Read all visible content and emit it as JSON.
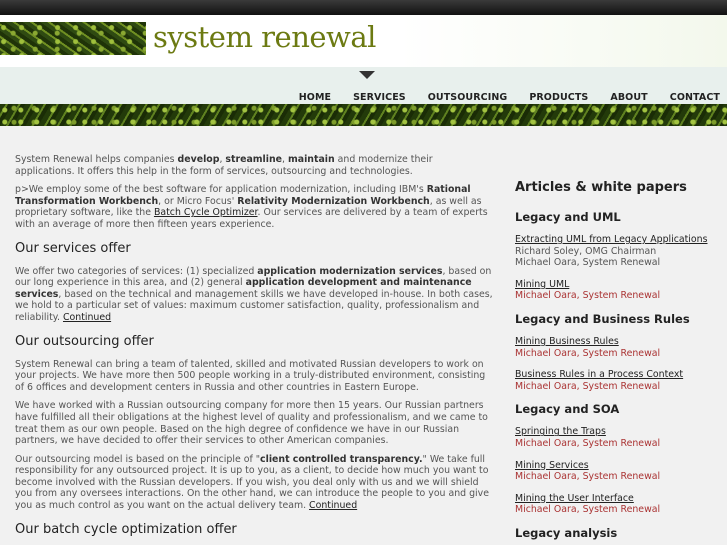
{
  "header": {
    "site_title": "system renewal"
  },
  "nav": {
    "items": [
      "HOME",
      "SERVICES",
      "OUTSOURCING",
      "PRODUCTS",
      "ABOUT",
      "CONTACT"
    ]
  },
  "main": {
    "intro_1": "System Renewal helps companies ",
    "intro_b1": "develop",
    "intro_b2": "streamline",
    "intro_b3": "maintain",
    "intro_2": " and modernize their applications. It offers this help in the form of services, outsourcing and technologies.",
    "p2_a": "p>We employ some of the best software for application modernization, including IBM's ",
    "p2_b1": "Rational Transformation Workbench",
    "p2_b": ", or Micro Focus' ",
    "p2_b2": "Relativity Modernization Workbench",
    "p2_c": ", as well as proprietary software, like the ",
    "p2_link": "Batch Cycle Optimizer",
    "p2_d": ". Our services are delivered by a team of experts with an average of more then fifteen years experience.",
    "h_services": "Our services offer",
    "p3_a": "We offer two categories of services: (1) specialized ",
    "p3_b1": "application modernization services",
    "p3_b": ", based on our long experience in this area, and (2) general ",
    "p3_b2": "application development and maintenance services",
    "p3_c": ", based on the technical and management skills we have developed in-house. In both cases, we hold to a particular set of values: maximum customer satisfaction, quality, professionalism and reliability. ",
    "p3_link": "Continued",
    "h_outsourcing": "Our outsourcing offer",
    "p4": "System Renewal can bring a team of talented, skilled and motivated Russian developers to work on your projects. We have more then 500 people working in a truly-distributed environment, consisting of 6 offices and development centers in Russia and other countries in Eastern Europe.",
    "p5": "We have worked with a Russian outsourcing company for more then 15 years. Our Russian partners have fulfilled all their obligations at the highest level of quality and professionalism, and we came to treat them as our own people. Based on the high degree of confidence we have in our Russian partners, we have decided to offer their services to other American companies.",
    "p6_a": "Our outsourcing model is based on the principle of \"",
    "p6_b": "client controlled transparency.",
    "p6_c": "\" We take full responsibility for any outsourced project. It is up to you, as a client, to decide how much you want to become involved with the Russian developers. If you wish, you deal only with us and we will shield you from any oversees interactions. On the other hand, we can introduce the people to you and give you as much control as you want on the actual delivery team. ",
    "p6_link": "Continued",
    "h_batch": "Our batch cycle optimization offer"
  },
  "sidebar": {
    "title": "Articles & white papers",
    "sec1": "Legacy and UML",
    "a1_title": "Extracting UML from Legacy Applications",
    "a1_by1": "Richard Soley, OMG Chairman",
    "a1_by2": "Michael Oara, System Renewal",
    "a2_title": "Mining UML",
    "a2_by": "Michael Oara, System Renewal",
    "sec2": "Legacy and Business Rules",
    "a3_title": "Mining Business Rules",
    "a3_by": "Michael Oara, System Renewal",
    "a4_title": "Business Rules in a Process Context",
    "a4_by": "Michael Oara, System Renewal",
    "sec3": "Legacy and SOA",
    "a5_title": "Springing the Traps",
    "a5_by": "Michael Oara, System Renewal",
    "a6_title": "Mining Services",
    "a6_by": "Michael Oara, System Renewal",
    "a7_title": "Mining the User Interface",
    "a7_by": "Michael Oara, System Renewal",
    "sec4": "Legacy analysis"
  }
}
